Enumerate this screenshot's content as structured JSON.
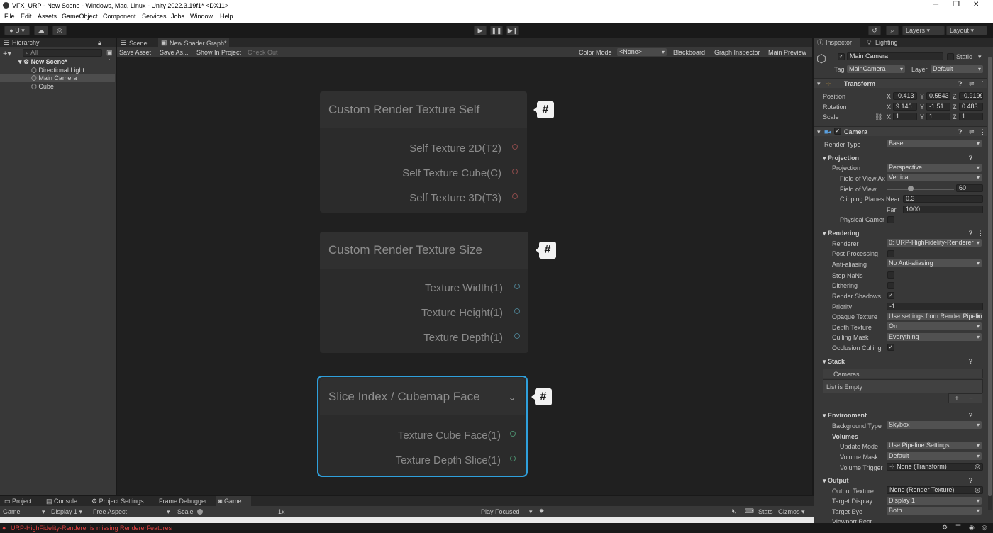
{
  "window": {
    "title": "VFX_URP - New Scene - Windows, Mac, Linux - Unity 2022.3.19f1* <DX11>",
    "minimize": "─",
    "maximize": "❐",
    "close": "✕"
  },
  "menu": [
    "File",
    "Edit",
    "Assets",
    "GameObject",
    "Component",
    "Services",
    "Jobs",
    "Window",
    "Help"
  ],
  "toolbar": {
    "account": "U",
    "layers": "Layers",
    "layout": "Layout"
  },
  "hierarchy": {
    "tab": "Hierarchy",
    "search_placeholder": "All",
    "items": [
      {
        "label": "New Scene*"
      },
      {
        "label": "Directional Light"
      },
      {
        "label": "Main Camera"
      },
      {
        "label": "Cube"
      }
    ]
  },
  "graph": {
    "tabs": [
      "Scene",
      "New Shader Graph*"
    ],
    "toolbar": {
      "save_asset": "Save Asset",
      "save_as": "Save As...",
      "show_in_project": "Show In Project",
      "check_out": "Check Out",
      "color_mode_label": "Color Mode",
      "color_mode_value": "<None>",
      "blackboard": "Blackboard",
      "graph_inspector": "Graph Inspector",
      "main_preview": "Main Preview"
    },
    "nodes": [
      {
        "title": "Custom Render Texture Self",
        "ports": [
          "Self Texture 2D(T2)",
          "Self Texture Cube(C)",
          "Self Texture 3D(T3)"
        ]
      },
      {
        "title": "Custom Render Texture Size",
        "ports": [
          "Texture Width(1)",
          "Texture Height(1)",
          "Texture Depth(1)"
        ]
      },
      {
        "title": "Slice Index / Cubemap Face",
        "ports": [
          "Texture Cube Face(1)",
          "Texture Depth Slice(1)"
        ]
      }
    ],
    "hash_symbol": "#",
    "colors": {
      "selected_outline": "#2fa0dc",
      "port_red": "#8a4a4a",
      "port_blue": "#4a7a8a",
      "port_green": "#4a8a6a"
    }
  },
  "inspector": {
    "tabs": [
      "Inspector",
      "Lighting"
    ],
    "object_name": "Main Camera",
    "static_label": "Static",
    "tag_label": "Tag",
    "tag_value": "MainCamera",
    "layer_label": "Layer",
    "layer_value": "Default",
    "transform": {
      "title": "Transform",
      "position": {
        "label": "Position",
        "x": "-0.413",
        "y": "0.5543",
        "z": "-0.9199"
      },
      "rotation": {
        "label": "Rotation",
        "x": "9.146",
        "y": "-1.51",
        "z": "0.483"
      },
      "scale": {
        "label": "Scale",
        "x": "1",
        "y": "1",
        "z": "1"
      },
      "axis_x": "X",
      "axis_y": "Y",
      "axis_z": "Z"
    },
    "camera": {
      "title": "Camera",
      "render_type": {
        "label": "Render Type",
        "value": "Base"
      },
      "projection_section": "Projection",
      "projection": {
        "label": "Projection",
        "value": "Perspective"
      },
      "fov_axis": {
        "label": "Field of View Ax",
        "value": "Vertical"
      },
      "fov": {
        "label": "Field of View",
        "value": "60",
        "fraction": 0.33
      },
      "clip_label": "Clipping Planes",
      "near": {
        "label": "Near",
        "value": "0.3"
      },
      "far": {
        "label": "Far",
        "value": "1000"
      },
      "physical": "Physical Camer",
      "rendering_section": "Rendering",
      "renderer": {
        "label": "Renderer",
        "value": "0: URP-HighFidelity-Renderer"
      },
      "post_processing": "Post Processing",
      "anti_aliasing": {
        "label": "Anti-aliasing",
        "value": "No Anti-aliasing"
      },
      "stop_nans": "Stop NaNs",
      "dithering": "Dithering",
      "render_shadows": "Render Shadows",
      "priority": {
        "label": "Priority",
        "value": "-1"
      },
      "opaque_texture": {
        "label": "Opaque Texture",
        "value": "Use settings from Render Pipeline"
      },
      "depth_texture": {
        "label": "Depth Texture",
        "value": "On"
      },
      "culling_mask": {
        "label": "Culling Mask",
        "value": "Everything"
      },
      "occlusion_culling": "Occlusion Culling",
      "stack_section": "Stack",
      "cameras_label": "Cameras",
      "list_empty": "List is Empty",
      "plus": "+",
      "minus": "−",
      "environment_section": "Environment",
      "background_type": {
        "label": "Background Type",
        "value": "Skybox"
      },
      "volumes_label": "Volumes",
      "update_mode": {
        "label": "Update Mode",
        "value": "Use Pipeline Settings"
      },
      "volume_mask": {
        "label": "Volume Mask",
        "value": "Default"
      },
      "volume_trigger": {
        "label": "Volume Trigger",
        "value": "None (Transform)"
      },
      "output_section": "Output",
      "output_texture": {
        "label": "Output Texture",
        "value": "None (Render Texture)"
      },
      "target_display": {
        "label": "Target Display",
        "value": "Display 1"
      },
      "target_eye": {
        "label": "Target Eye",
        "value": "Both"
      },
      "viewport_rect": "Viewport Rect"
    }
  },
  "bottom": {
    "tabs": [
      "Project",
      "Console",
      "Project Settings",
      "Frame Debugger",
      "Game"
    ],
    "game_toolbar": {
      "mode": "Game",
      "display": "Display 1",
      "aspect": "Free Aspect",
      "scale_label": "Scale",
      "scale_value": "1x",
      "play_focused": "Play Focused",
      "stats": "Stats",
      "gizmos": "Gizmos"
    }
  },
  "status": {
    "message": "URP-HighFidelity-Renderer is missing RendererFeatures",
    "error_color": "#e04040"
  }
}
